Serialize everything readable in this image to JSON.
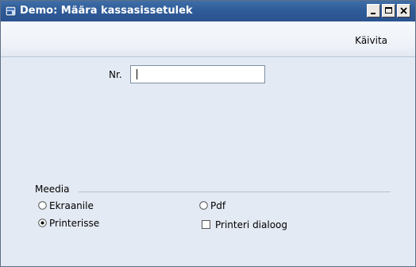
{
  "window": {
    "title": "Demo: Määra kassasissetulek",
    "icon": "app-icon"
  },
  "toolbar": {
    "run_label": "Käivita"
  },
  "form": {
    "nr_label": "Nr.",
    "nr_value": ""
  },
  "media": {
    "group_label": "Meedia",
    "options": [
      {
        "label": "Ekraanile",
        "type": "radio",
        "checked": false
      },
      {
        "label": "Printerisse",
        "type": "radio",
        "checked": true
      },
      {
        "label": "Pdf",
        "type": "radio",
        "checked": false
      },
      {
        "label": "Printeri dialoog",
        "type": "checkbox",
        "checked": false
      }
    ]
  }
}
